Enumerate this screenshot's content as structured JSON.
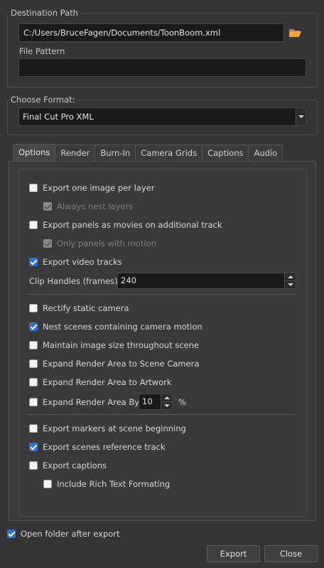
{
  "destination": {
    "title": "Destination Path",
    "path_value": "C:/Users/BruceFagen/Documents/ToonBoom.xml",
    "file_pattern_label": "File Pattern",
    "file_pattern_value": ""
  },
  "format": {
    "title": "Choose Format:",
    "selected": "Final Cut Pro XML"
  },
  "tabs": [
    "Options",
    "Render",
    "Burn-In",
    "Camera Grids",
    "Captions",
    "Audio"
  ],
  "options": {
    "export_one_image": "Export one image per layer",
    "always_nest": "Always nest layers",
    "export_panels_movies": "Export panels as movies on additional track",
    "only_panels_motion": "Only panels with motion",
    "export_video_tracks": "Export video tracks",
    "clip_handles_label": "Clip Handles (frames):",
    "clip_handles_value": "240",
    "rectify_static": "Rectify static camera",
    "nest_scenes": "Nest scenes containing camera motion",
    "maintain_image_size": "Maintain image size throughout scene",
    "expand_scene_camera": "Expand Render Area to Scene Camera",
    "expand_artwork": "Expand Render Area to Artwork",
    "expand_by_label": "Expand Render Area By:",
    "expand_by_value": "10",
    "expand_by_unit": "%",
    "export_markers": "Export markers at scene beginning",
    "export_scenes_ref": "Export scenes reference track",
    "export_captions": "Export captions",
    "rich_text": "Include Rich Text Formating"
  },
  "footer": {
    "open_folder": "Open folder after export",
    "export_label": "Export",
    "close_label": "Close"
  },
  "colors": {
    "background": "#353535",
    "field": "#1a1a1a",
    "checkbox_checked": "#2f6fd6",
    "folder_icon": "#f0a23a"
  }
}
